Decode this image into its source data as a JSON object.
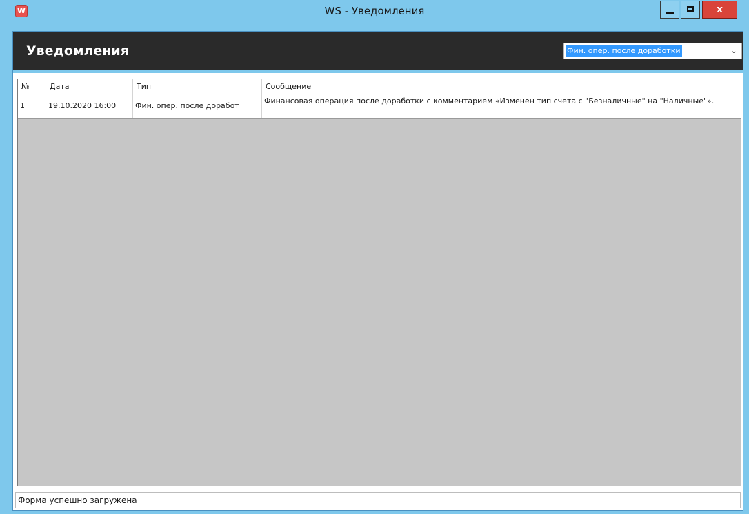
{
  "window": {
    "title": "WS - Уведомления",
    "app_icon_glyph": "W",
    "close_glyph": "x",
    "accent_color": "#7ec8ec",
    "close_color": "#d9443a"
  },
  "header": {
    "title": "Уведомления",
    "background_color": "#2a2a2a",
    "filter": {
      "selected_value": "Фин. опер. после доработки",
      "arrow_glyph": "⌄"
    }
  },
  "grid": {
    "columns": [
      "№",
      "Дата",
      "Тип",
      "Сообщение"
    ],
    "rows": [
      {
        "num": "1",
        "date": "19.10.2020 16:00",
        "type": "Фин. опер. после доработ",
        "message": "Финансовая операция после доработки с комментарием «Изменен тип счета с \"Безналичные\" на \"Наличные\"»."
      }
    ],
    "empty_area_color": "#c6c6c6"
  },
  "status": {
    "text": "Форма успешно загружена"
  },
  "icons": {
    "app": "app-logo-icon",
    "minimize": "minimize-icon",
    "maximize": "maximize-icon",
    "close": "close-icon",
    "dropdown": "chevron-down-icon"
  }
}
